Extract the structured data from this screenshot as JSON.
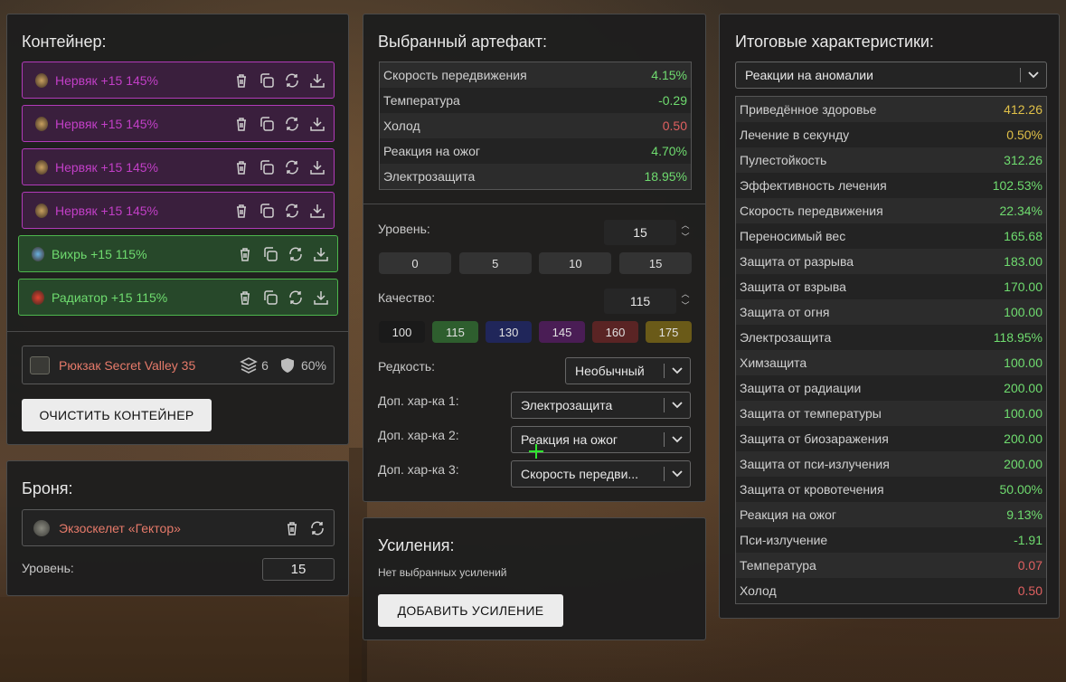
{
  "container": {
    "title": "Контейнер:",
    "items": [
      {
        "name": "Нервяк +15 145%",
        "rarity": "purple"
      },
      {
        "name": "Нервяк +15 145%",
        "rarity": "purple"
      },
      {
        "name": "Нервяк +15 145%",
        "rarity": "purple"
      },
      {
        "name": "Нервяк +15 145%",
        "rarity": "purple"
      },
      {
        "name": "Вихрь +15 115%",
        "rarity": "green"
      },
      {
        "name": "Радиатор +15 115%",
        "rarity": "green"
      }
    ],
    "backpack": {
      "name": "Рюкзак Secret Valley 35",
      "slots": "6",
      "protection": "60%"
    },
    "clear_label": "ОЧИСТИТЬ КОНТЕЙНЕР"
  },
  "armor": {
    "title": "Броня:",
    "item": "Экзоскелет «Гектор»",
    "level_label": "Уровень:",
    "level_value": "15"
  },
  "artifact": {
    "title": "Выбранный артефакт:",
    "stats": [
      {
        "label": "Скорость передвижения",
        "value": "4.15%",
        "color": "green"
      },
      {
        "label": "Температура",
        "value": "-0.29",
        "color": "green"
      },
      {
        "label": "Холод",
        "value": "0.50",
        "color": "red"
      },
      {
        "label": "Реакция на ожог",
        "value": "4.70%",
        "color": "green"
      },
      {
        "label": "Электрозащита",
        "value": "18.95%",
        "color": "green"
      }
    ],
    "level_label": "Уровень:",
    "level_value": "15",
    "level_presets": [
      "0",
      "5",
      "10",
      "15"
    ],
    "quality_label": "Качество:",
    "quality_value": "115",
    "quality_presets": [
      "100",
      "115",
      "130",
      "145",
      "160",
      "175"
    ],
    "rarity_label": "Редкость:",
    "rarity_value": "Необычный",
    "extra1_label": "Доп. хар-ка 1:",
    "extra1_value": "Электрозащита",
    "extra2_label": "Доп. хар-ка 2:",
    "extra2_value": "Реакция на ожог",
    "extra3_label": "Доп. хар-ка 3:",
    "extra3_value": "Скорость передви..."
  },
  "boosts": {
    "title": "Усиления:",
    "empty_text": "Нет выбранных усилений",
    "add_label": "ДОБАВИТЬ УСИЛЕНИЕ"
  },
  "totals": {
    "title": "Итоговые характеристики:",
    "filter_value": "Реакции на аномалии",
    "stats": [
      {
        "label": "Приведённое здоровье",
        "value": "412.26",
        "color": "yellow"
      },
      {
        "label": "Лечение в секунду",
        "value": "0.50%",
        "color": "yellow"
      },
      {
        "label": "Пулестойкость",
        "value": "312.26",
        "color": "green"
      },
      {
        "label": "Эффективность лечения",
        "value": "102.53%",
        "color": "green"
      },
      {
        "label": "Скорость передвижения",
        "value": "22.34%",
        "color": "green"
      },
      {
        "label": "Переносимый вес",
        "value": "165.68",
        "color": "green"
      },
      {
        "label": "Защита от разрыва",
        "value": "183.00",
        "color": "green"
      },
      {
        "label": "Защита от взрыва",
        "value": "170.00",
        "color": "green"
      },
      {
        "label": "Защита от огня",
        "value": "100.00",
        "color": "green"
      },
      {
        "label": "Электрозащита",
        "value": "118.95%",
        "color": "green"
      },
      {
        "label": "Химзащита",
        "value": "100.00",
        "color": "green"
      },
      {
        "label": "Защита от радиации",
        "value": "200.00",
        "color": "green"
      },
      {
        "label": "Защита от температуры",
        "value": "100.00",
        "color": "green"
      },
      {
        "label": "Защита от биозаражения",
        "value": "200.00",
        "color": "green"
      },
      {
        "label": "Защита от пси-излучения",
        "value": "200.00",
        "color": "green"
      },
      {
        "label": "Защита от кровотечения",
        "value": "50.00%",
        "color": "green"
      },
      {
        "label": "Реакция на ожог",
        "value": "9.13%",
        "color": "green"
      },
      {
        "label": "Пси-излучение",
        "value": "-1.91",
        "color": "green"
      },
      {
        "label": "Температура",
        "value": "0.07",
        "color": "red"
      },
      {
        "label": "Холод",
        "value": "0.50",
        "color": "red"
      }
    ]
  },
  "colors": {
    "purple_bg": "#3a1f3d",
    "purple_border": "#b13ab8",
    "green_bg": "#27482a",
    "green_border": "#4db64d",
    "stat_green": "#6fdc6f",
    "stat_red": "#e06060",
    "stat_yellow": "#e0c048"
  }
}
